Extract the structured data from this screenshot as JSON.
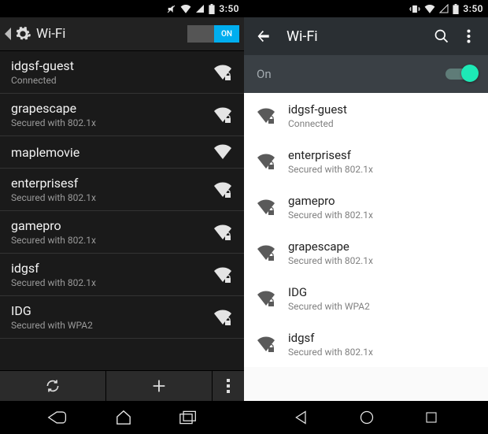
{
  "left": {
    "statusbar": {
      "time": "3:50"
    },
    "appbar": {
      "title": "Wi-Fi",
      "toggle_text": "ON"
    },
    "networks": [
      {
        "ssid": "idgsf-guest",
        "sub": "Connected",
        "secured": true
      },
      {
        "ssid": "grapescape",
        "sub": "Secured with 802.1x",
        "secured": true
      },
      {
        "ssid": "maplemovie",
        "sub": "",
        "secured": false
      },
      {
        "ssid": "enterprisesf",
        "sub": "Secured with 802.1x",
        "secured": true
      },
      {
        "ssid": "gamepro",
        "sub": "Secured with 802.1x",
        "secured": true
      },
      {
        "ssid": "idgsf",
        "sub": "Secured with 802.1x",
        "secured": true
      },
      {
        "ssid": "IDG",
        "sub": "Secured with WPA2",
        "secured": true
      }
    ]
  },
  "right": {
    "statusbar": {
      "time": "3:50"
    },
    "appbar": {
      "title": "Wi-Fi"
    },
    "onrow": {
      "label": "On"
    },
    "networks": [
      {
        "ssid": "idgsf-guest",
        "sub": "Connected",
        "secured": true
      },
      {
        "ssid": "enterprisesf",
        "sub": "Secured with 802.1x",
        "secured": true
      },
      {
        "ssid": "gamepro",
        "sub": "Secured with 802.1x",
        "secured": true
      },
      {
        "ssid": "grapescape",
        "sub": "Secured with 802.1x",
        "secured": true
      },
      {
        "ssid": "IDG",
        "sub": "Secured with WPA2",
        "secured": true
      },
      {
        "ssid": "idgsf",
        "sub": "Secured with 802.1x",
        "secured": true
      }
    ]
  }
}
